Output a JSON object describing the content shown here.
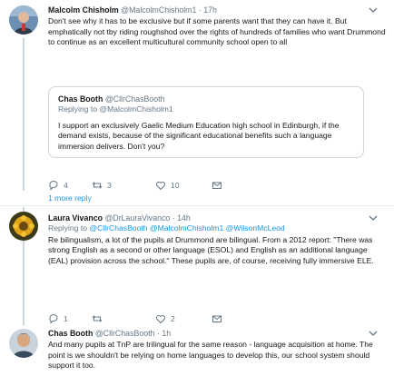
{
  "tweets": [
    {
      "name": "Malcolm Chisholm",
      "handle": "@MalcolmChisholm1",
      "time": "17h",
      "text": "Don't see why it has to be exclusive but if some parents want that they can have it. But emphatically not tby riding roughshod over the rights of hundreds of families who want Drummond to continue as an excellent multicultural community school open to all",
      "quote": {
        "name": "Chas Booth",
        "handle": "@CllrChasBooth",
        "replying_prefix": "Replying to",
        "replying_to": "@MalcolmChisholm1",
        "text": "I support an exclusively Gaelic Medium Education high school in Edinburgh, if the demand exists, because of the significant educational benefits such a language immersion delivers. Don't you?"
      },
      "reply_count": "4",
      "retweet_count": "3",
      "like_count": "10",
      "more_replies": "1 more reply"
    },
    {
      "name": "Laura Vivanco",
      "handle": "@DrLauraVivanco",
      "time": "14h",
      "replying_prefix": "Replying to",
      "replying_to": "@CllrChasBooth @MalcolmChisholm1 @WilsonMcLeod",
      "text": "Re bilingualism, a lot of the pupils at Drummond are bilingual. From a 2012 report: \"There was strong English as a second or other language (ESOL) and English as an additional language (EAL) provision across the school.\" These pupils are, of course, receiving fully immersive ELE.",
      "reply_count": "1",
      "retweet_count": "",
      "like_count": "2"
    },
    {
      "name": "Chas Booth",
      "handle": "@CllrChasBooth",
      "time": "1h",
      "text": "And many pupils at TnP are trilingual for the same reason - language acquisition at home. The point is we shouldn't be relying on home languages to develop this, our school system should support it too."
    }
  ],
  "separator": "·",
  "colors": {
    "link": "#1b95e0",
    "muted": "#657786",
    "border": "#ccd6dd"
  }
}
